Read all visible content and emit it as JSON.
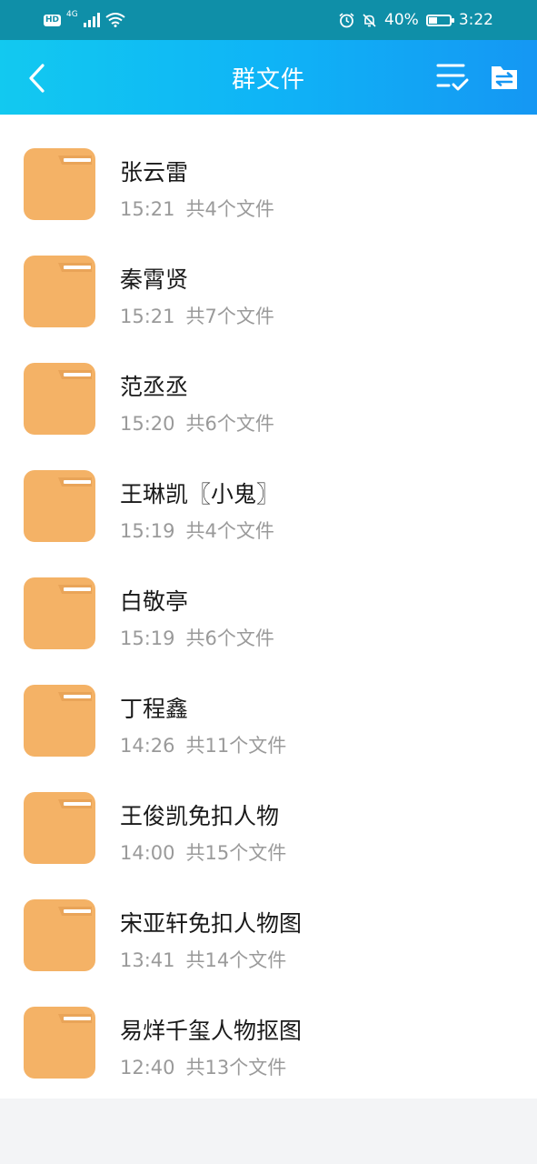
{
  "status_bar": {
    "hd": "HD",
    "network": "4G",
    "battery": "40%",
    "time": "3:22"
  },
  "titlebar": {
    "title": "群文件"
  },
  "colors": {
    "folder": "#f4b266",
    "folder_tab": "#e9a458",
    "title_gradient_start": "#12c9f0",
    "title_gradient_end": "#1597f3"
  },
  "folders": [
    {
      "name": "张云雷",
      "time": "15:21",
      "count": "共4个文件"
    },
    {
      "name": "秦霄贤",
      "time": "15:21",
      "count": "共7个文件"
    },
    {
      "name": "范丞丞",
      "time": "15:20",
      "count": "共6个文件"
    },
    {
      "name": "王琳凯〖小鬼〗",
      "time": "15:19",
      "count": "共4个文件"
    },
    {
      "name": "白敬亭",
      "time": "15:19",
      "count": "共6个文件"
    },
    {
      "name": "丁程鑫",
      "time": "14:26",
      "count": "共11个文件"
    },
    {
      "name": "王俊凯免扣人物",
      "time": "14:00",
      "count": "共15个文件"
    },
    {
      "name": "宋亚轩免扣人物图",
      "time": "13:41",
      "count": "共14个文件"
    },
    {
      "name": "易烊千玺人物抠图",
      "time": "12:40",
      "count": "共13个文件"
    }
  ]
}
